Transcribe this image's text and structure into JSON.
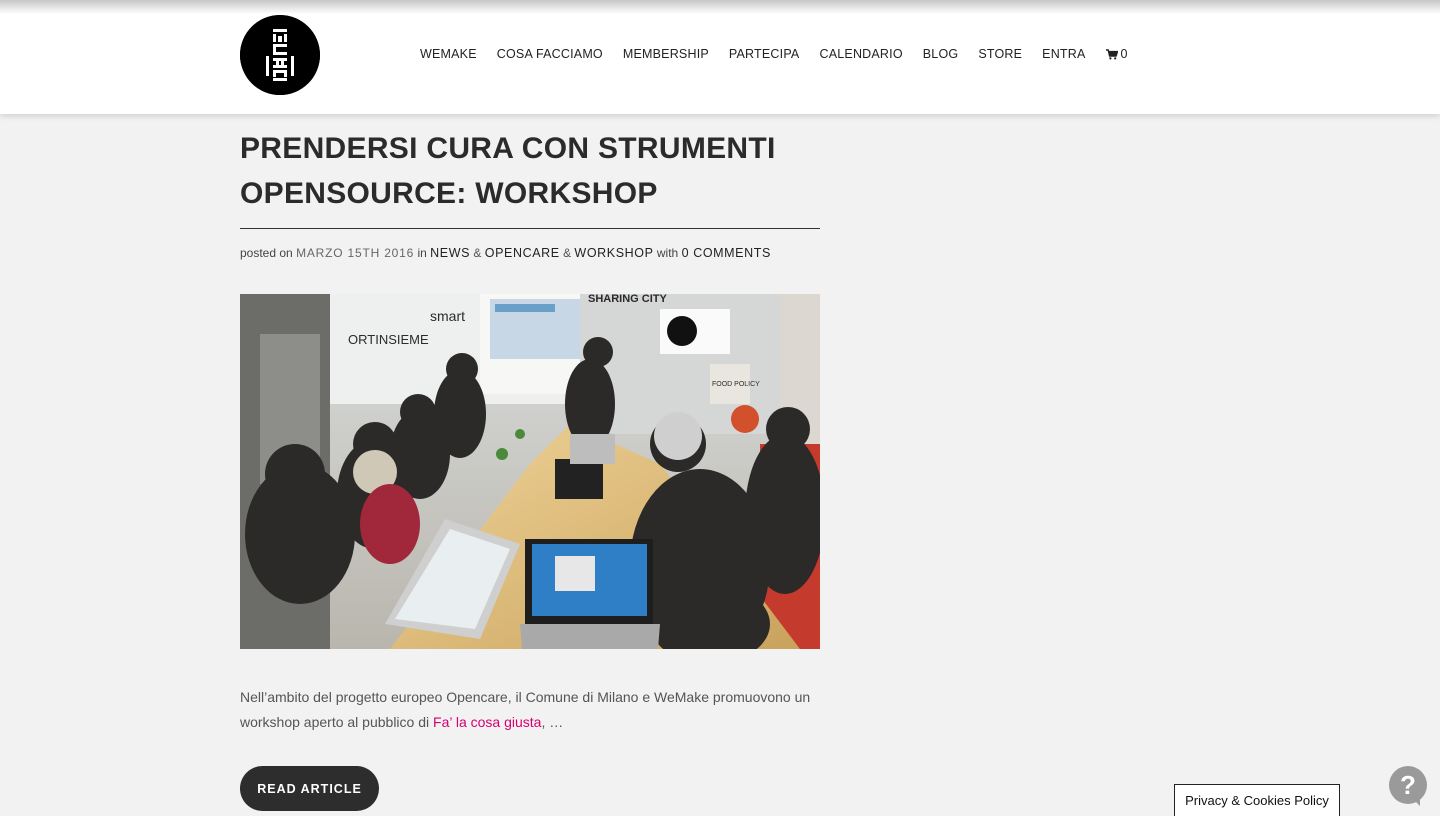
{
  "header": {
    "logo_alt": "WeMake",
    "nav": [
      {
        "label": "WEMAKE"
      },
      {
        "label": "COSA FACCIAMO"
      },
      {
        "label": "MEMBERSHIP"
      },
      {
        "label": "PARTECIPA"
      },
      {
        "label": "CALENDARIO"
      },
      {
        "label": "BLOG"
      },
      {
        "label": "STORE"
      },
      {
        "label": "ENTRA"
      }
    ],
    "cart_count": "0"
  },
  "post": {
    "title_line1": "PRENDERSI CURA CON STRUMENTI",
    "title_line2": "OPENSOURCE: WORKSHOP",
    "meta": {
      "posted_on": "posted on",
      "date": "MARZO 15TH 2016",
      "in": "in",
      "categories": [
        "NEWS",
        "OPENCARE",
        "WORKSHOP"
      ],
      "amp": "&",
      "with": "with",
      "comments": "0 COMMENTS"
    },
    "image": {
      "description_icon": "workshop-photo",
      "sign_sharing_city": "SHARING CITY",
      "sign_smart": "smart",
      "sign_ortinsieme": "ORTINSIEME",
      "sign_food_policy": "FOOD POLICY"
    },
    "excerpt_before": "Nell’ambito del progetto europeo Opencare, il Comune di Milano e WeMake promuovono un workshop aperto al pubblico di ",
    "excerpt_link": "Fa’ la cosa giusta",
    "excerpt_after": ", …",
    "read_more": "READ ARTICLE"
  },
  "cookie_policy": "Privacy & Cookies Policy",
  "help_icon": "?",
  "colors": {
    "background": "#f2f2f2",
    "accent_link": "#d6006f",
    "button": "#2d2d2d"
  }
}
